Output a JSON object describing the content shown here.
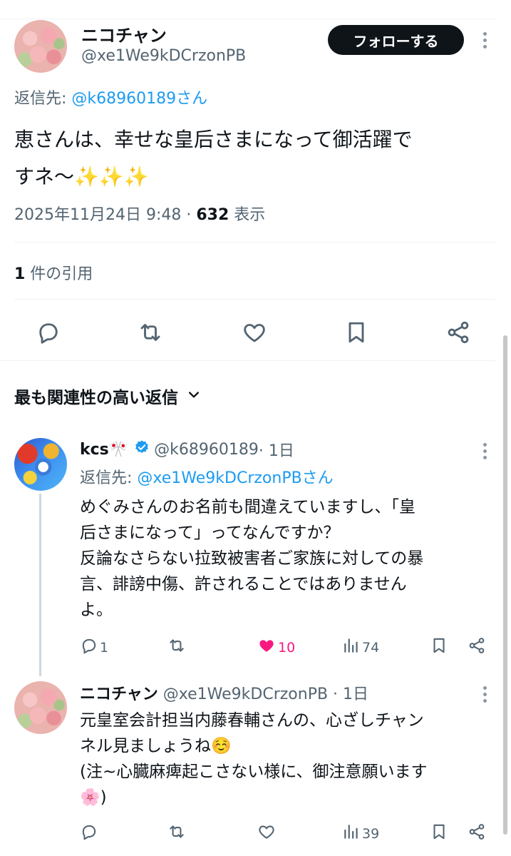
{
  "main_tweet": {
    "display_name": "ニコチャン",
    "handle": "@xe1We9kDCrzonPB",
    "follow_label": "フォローする",
    "reply_to_prefix": "返信先: ",
    "reply_to_handle": "@k68960189さん",
    "text_line1": "恵さんは、幸せな皇后さまになって御活躍で",
    "text_line2": "すネ〜✨✨✨",
    "timestamp": "2025年11月24日 9:48 · ",
    "views_count": "632",
    "views_label": " 表示",
    "quotes_count": "1",
    "quotes_label": " 件の引用"
  },
  "sort": {
    "label": "最も関連性の高い返信"
  },
  "replies": [
    {
      "display_name": "kcs🎌",
      "handle": "@k68960189",
      "time": " · 1日",
      "reply_to_prefix": "返信先: ",
      "reply_to_handle": "@xe1We9kDCrzonPBさん",
      "lines": [
        "めぐみさんのお名前も間違えていますし、「皇",
        "后さまになって」ってなんですか？",
        "反論なさらない拉致被害者ご家族に対しての暴",
        "言、誹謗中傷、許されることではありません",
        "よ。"
      ],
      "stats": {
        "replies": "1",
        "retweets": "",
        "likes": "10",
        "views": "74"
      }
    },
    {
      "display_name": "ニコチャン",
      "handle": "@xe1We9kDCrzonPB",
      "time": " · 1日",
      "lines": [
        "元皇室会計担当内藤春輔さんの、心ざしチャン",
        "ネル見ましょうね☺️",
        "(注~心臓麻痺起こさない様に、御注意願います",
        "🌸)"
      ],
      "stats": {
        "replies": "",
        "retweets": "",
        "likes": "",
        "views": "39"
      }
    }
  ],
  "colors": {
    "text": "#0f1419",
    "secondary": "#536471",
    "link": "#1d9bf0",
    "like_active": "#f91880",
    "verified": "#1d9bf0"
  }
}
